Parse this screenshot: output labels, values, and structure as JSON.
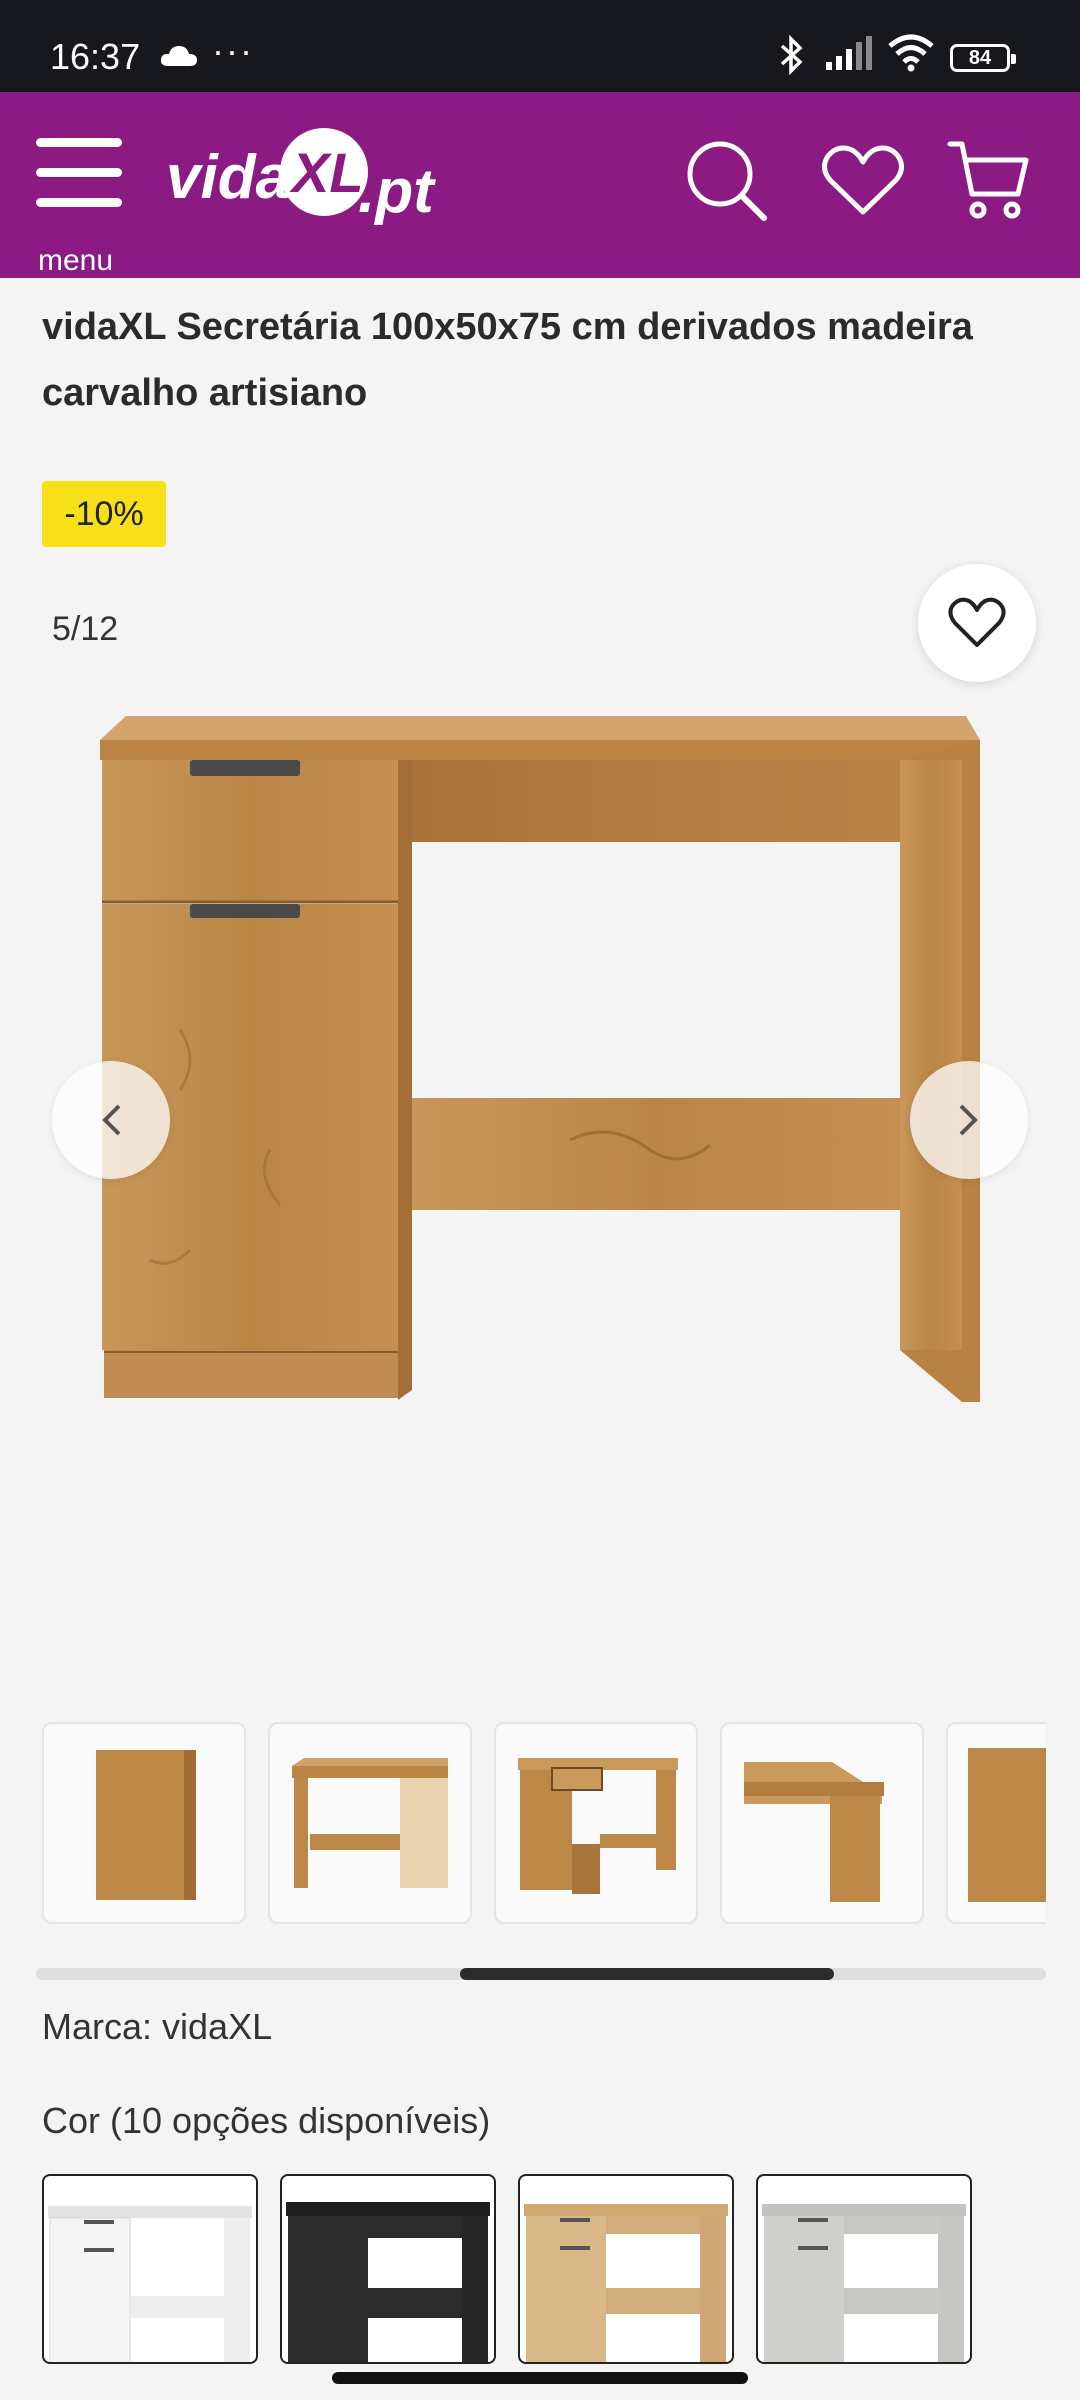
{
  "status_bar": {
    "time": "16:37",
    "more": "···",
    "battery": "84"
  },
  "header": {
    "menu_label": "menu",
    "logo_left": "vida",
    "logo_mark": "XL",
    "logo_right": ".pt",
    "brand_color": "#8b1a82"
  },
  "product": {
    "title": "vidaXL Secretária 100x50x75 cm derivados madeira carvalho artisiano",
    "discount": "-10%",
    "image_counter": "5/12",
    "brand_line": "Marca: vidaXL",
    "color_line": "Cor (10 opções disponíveis)"
  },
  "thumbnails": [
    {
      "name": "side-view"
    },
    {
      "name": "back-view"
    },
    {
      "name": "open-view"
    },
    {
      "name": "top-detail"
    },
    {
      "name": "edge-detail"
    }
  ],
  "thumb_scroll_progress": 0.42,
  "color_options": [
    {
      "name": "white",
      "color": "#f2f2f2"
    },
    {
      "name": "black",
      "color": "#2a2a2a"
    },
    {
      "name": "sonoma-oak",
      "color": "#d4b183"
    },
    {
      "name": "concrete-grey",
      "color": "#c9c9c6"
    }
  ],
  "wood_color": "#c0904f"
}
